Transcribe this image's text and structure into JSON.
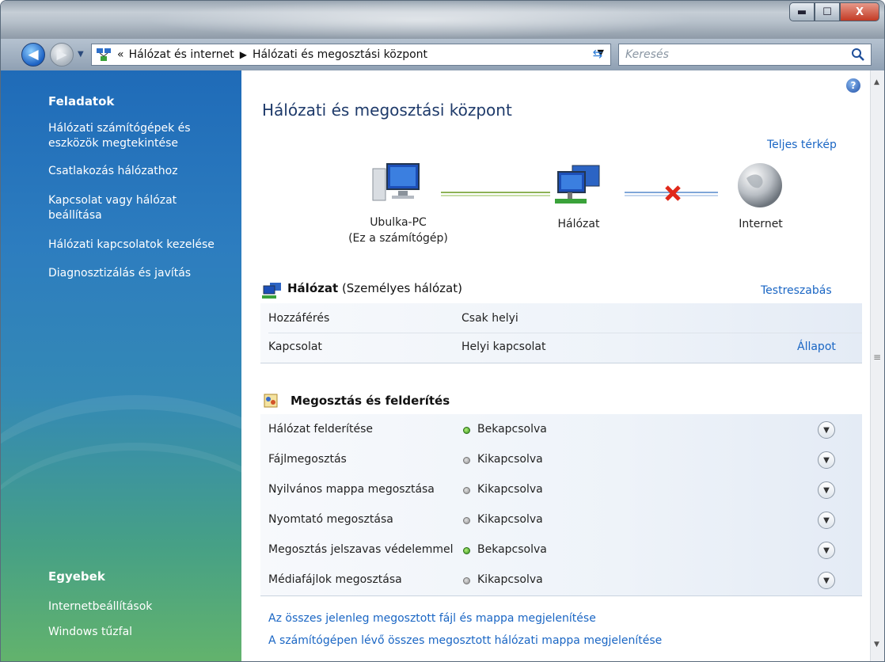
{
  "window": {
    "minimize_label": "▬",
    "maximize_label": "☐",
    "close_label": "X"
  },
  "address": {
    "chevron": "«",
    "crumbs": [
      "Hálózat és internet",
      "Hálózati és megosztási központ"
    ],
    "separator": "▶"
  },
  "search": {
    "placeholder": "Keresés"
  },
  "sidebar": {
    "tasks_title": "Feladatok",
    "tasks": [
      "Hálózati számítógépek és eszközök megtekintése",
      "Csatlakozás hálózathoz",
      "Kapcsolat vagy hálózat beállítása",
      "Hálózati kapcsolatok kezelése",
      "Diagnosztizálás és javítás"
    ],
    "other_title": "Egyebek",
    "other": [
      "Internetbeállítások",
      "Windows tűzfal"
    ]
  },
  "main": {
    "title": "Hálózati és megosztási központ",
    "full_map_link": "Teljes térkép",
    "map": {
      "pc_name": "Ubulka-PC",
      "pc_sub": "(Ez a számítógép)",
      "network": "Hálózat",
      "internet": "Internet"
    },
    "network": {
      "name": "Hálózat",
      "type": "(Személyes hálózat)",
      "customize_link": "Testreszabás",
      "rows": [
        {
          "label": "Hozzáférés",
          "value": "Csak helyi",
          "action": ""
        },
        {
          "label": "Kapcsolat",
          "value": "Helyi kapcsolat",
          "action": "Állapot"
        }
      ]
    },
    "sharing": {
      "title": "Megosztás és felderítés",
      "rows": [
        {
          "label": "Hálózat felderítése",
          "value": "Bekapcsolva",
          "on": true
        },
        {
          "label": "Fájlmegosztás",
          "value": "Kikapcsolva",
          "on": false
        },
        {
          "label": "Nyilvános mappa megosztása",
          "value": "Kikapcsolva",
          "on": false
        },
        {
          "label": "Nyomtató megosztása",
          "value": "Kikapcsolva",
          "on": false
        },
        {
          "label": "Megosztás jelszavas védelemmel",
          "value": "Bekapcsolva",
          "on": true
        },
        {
          "label": "Médiafájlok megosztása",
          "value": "Kikapcsolva",
          "on": false
        }
      ]
    },
    "bottom_links": [
      "Az összes jelenleg megosztott fájl és mappa megjelenítése",
      "A számítógépen lévő összes megosztott hálózati mappa megjelenítése"
    ]
  },
  "icons": {
    "back": "back-arrow-icon",
    "forward": "forward-arrow-icon",
    "refresh": "refresh-icon",
    "search": "search-icon",
    "help": "help-icon",
    "expand": "chevron-down-icon"
  },
  "colors": {
    "link": "#1a66c4",
    "title": "#1e3a6a",
    "status_on": "#2f8f19",
    "status_off": "#8d8d8d",
    "disconnect": "#e0281a"
  }
}
